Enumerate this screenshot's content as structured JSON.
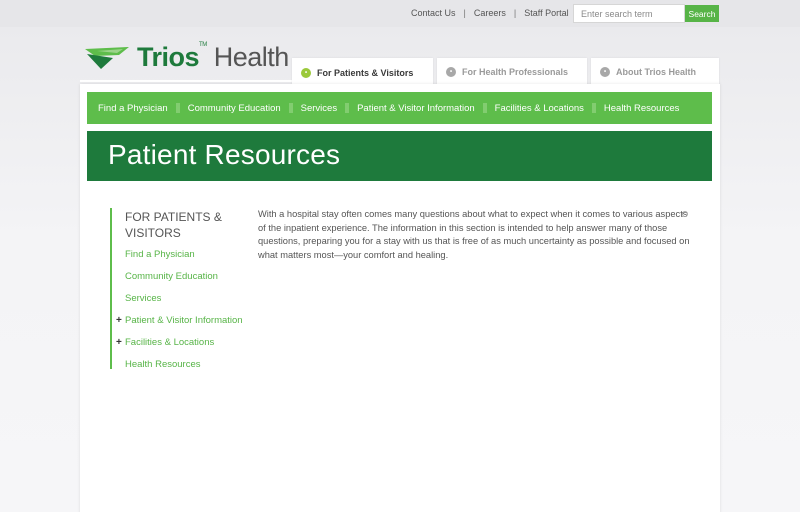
{
  "utility": {
    "links": [
      "Contact Us",
      "Careers",
      "Staff Portal"
    ],
    "search_placeholder": "Enter search term",
    "search_button": "Search"
  },
  "logo": {
    "brand_bold": "Trios",
    "tm": "TM",
    "brand_light": "Health",
    "colors": {
      "green": "#1e7a3c",
      "light_green": "#5ebd4b"
    }
  },
  "tabs": [
    {
      "label": "For Patients & Visitors",
      "active": true
    },
    {
      "label": "For Health Professionals",
      "active": false
    },
    {
      "label": "About Trios Health",
      "active": false
    }
  ],
  "mainnav": [
    "Find a Physician",
    "Community Education",
    "Services",
    "Patient & Visitor Information",
    "Facilities & Locations",
    "Health Resources"
  ],
  "banner_title": "Patient Resources",
  "sidenav": {
    "title": "FOR PATIENTS & VISITORS",
    "items": [
      {
        "label": "Find a Physician",
        "expandable": false
      },
      {
        "label": "Community Education",
        "expandable": false
      },
      {
        "label": "Services",
        "expandable": false
      },
      {
        "label": "Patient & Visitor Information",
        "expandable": true
      },
      {
        "label": "Facilities & Locations",
        "expandable": true
      },
      {
        "label": "Health Resources",
        "expandable": false
      }
    ],
    "expand_glyph": "+"
  },
  "intro_text": "With a hospital stay often comes many questions about what to expect when it comes to various aspects of the inpatient experience. The information in this section is intended to help answer many of those questions, preparing you for a stay with us that is free of as much uncertainty as possible and focused on what matters most—your comfort and healing."
}
